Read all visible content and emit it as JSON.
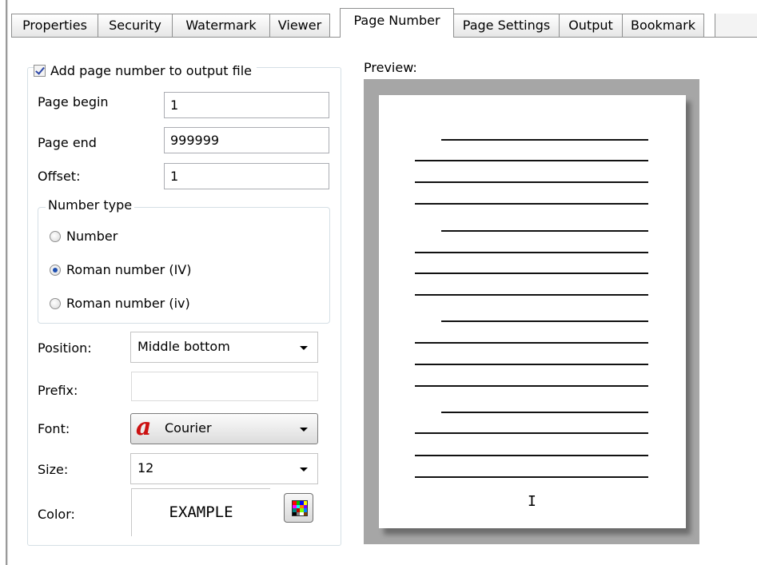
{
  "tabs": [
    {
      "label": "Properties",
      "active": false
    },
    {
      "label": "Security",
      "active": false
    },
    {
      "label": "Watermark",
      "active": false
    },
    {
      "label": "Viewer",
      "active": false
    },
    {
      "label": "Page Number",
      "active": true
    },
    {
      "label": "Page Settings",
      "active": false
    },
    {
      "label": "Output",
      "active": false
    },
    {
      "label": "Bookmark",
      "active": false
    }
  ],
  "page_number": {
    "add_checkbox_label": "Add page number to output file",
    "add_checked": true,
    "page_begin_label": "Page begin",
    "page_begin_value": "1",
    "page_end_label": "Page end",
    "page_end_value": "999999",
    "offset_label": "Offset:",
    "offset_value": "1",
    "number_type_title": "Number type",
    "number_types": [
      {
        "label": "Number",
        "selected": false
      },
      {
        "label": "Roman number (IV)",
        "selected": true
      },
      {
        "label": "Roman number (iv)",
        "selected": false
      }
    ],
    "position_label": "Position:",
    "position_value": "Middle bottom",
    "prefix_label": "Prefix:",
    "prefix_value": "",
    "font_label": "Font:",
    "font_value": "Courier",
    "font_icon_glyph": "a",
    "size_label": "Size:",
    "size_value": "12",
    "color_label": "Color:",
    "color_example": "EXAMPLE"
  },
  "preview": {
    "label": "Preview:",
    "page_number_text": "I"
  },
  "colors": {
    "palette_swatches": [
      "#ff0000",
      "#00c000",
      "#0000ff",
      "#ffff00",
      "#ff00ff",
      "#00ffff",
      "#ff8000",
      "#8000ff",
      "#008080",
      "#c00000",
      "#80ff00",
      "#0080ff",
      "#000000",
      "#808080",
      "#ffffff",
      "#804000"
    ]
  }
}
